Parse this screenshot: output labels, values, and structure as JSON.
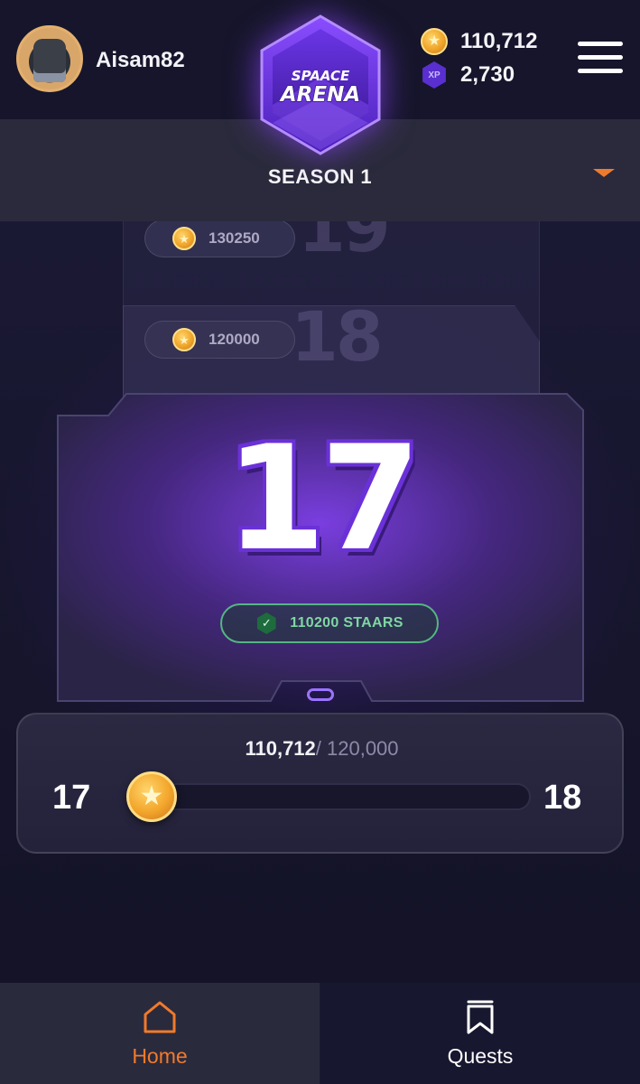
{
  "header": {
    "username": "Aisam82",
    "logo_line1": "SPAACE",
    "logo_line2": "ARENA",
    "coins": "110,712",
    "xp": "2,730",
    "xp_icon_text": "XP",
    "icons": {
      "avatar": "user-avatar",
      "coin": "star-coin-icon",
      "xp": "xp-hexagon-icon",
      "menu": "hamburger-menu-icon"
    }
  },
  "season": {
    "title": "SEASON 1",
    "caret_icon": "caret-down-icon",
    "accent_color": "#f07a2b"
  },
  "levels": {
    "upcoming": [
      {
        "level": "19",
        "staars": "130250"
      },
      {
        "level": "18",
        "staars": "120000"
      }
    ],
    "current": {
      "level": "17",
      "staars_label": "110200 STAARS",
      "status_icon": "check-shield-icon"
    }
  },
  "progress": {
    "current": "110,712",
    "target": "/ 120,000",
    "from_level": "17",
    "to_level": "18",
    "fraction": 0.0,
    "marker_icon": "star-coin-icon"
  },
  "nav": {
    "items": [
      {
        "label": "Home",
        "icon": "home-icon",
        "active": true
      },
      {
        "label": "Quests",
        "icon": "bookmark-icon",
        "active": false
      }
    ],
    "active_color": "#f07a2b"
  }
}
